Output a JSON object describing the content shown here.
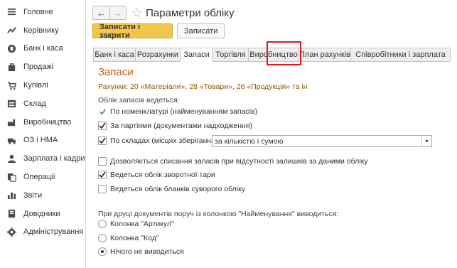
{
  "sidebar": {
    "items": [
      {
        "label": "Головне",
        "icon": "menu-icon"
      },
      {
        "label": "Керівнику",
        "icon": "chart-line-icon"
      },
      {
        "label": "Банк і каса",
        "icon": "coin-icon"
      },
      {
        "label": "Продажі",
        "icon": "shopping-bag-icon"
      },
      {
        "label": "Купівлі",
        "icon": "cart-icon"
      },
      {
        "label": "Склад",
        "icon": "warehouse-icon"
      },
      {
        "label": "Виробництво",
        "icon": "factory-icon"
      },
      {
        "label": "ОЗ і НМА",
        "icon": "truck-icon"
      },
      {
        "label": "Зарплата і кадри",
        "icon": "person-icon"
      },
      {
        "label": "Операції",
        "icon": "operations-icon"
      },
      {
        "label": "Звіти",
        "icon": "bar-chart-icon"
      },
      {
        "label": "Довідники",
        "icon": "book-icon"
      },
      {
        "label": "Адміністрування",
        "icon": "gear-icon"
      }
    ]
  },
  "header": {
    "back": "←",
    "forward": "→",
    "star": "☆",
    "title": "Параметри обліку"
  },
  "toolbar": {
    "save_close_label": "Записати і закрити",
    "save_label": "Записати"
  },
  "tabs": [
    {
      "label": "Банк і каса",
      "active": false
    },
    {
      "label": "Розрахунки",
      "active": false
    },
    {
      "label": "Запаси",
      "active": true
    },
    {
      "label": "Торгівля",
      "active": false
    },
    {
      "label": "Виробництво",
      "active": false
    },
    {
      "label": "План рахунків",
      "active": false
    },
    {
      "label": "Співробітники і зарплата",
      "active": false
    }
  ],
  "content": {
    "heading": "Запаси",
    "accounts": "Рахунки: 20 «Матеріали», 28 «Товари», 26 «Продукція» та ін",
    "section_label": "Облік запасів ведеться:",
    "by_nomenclature": "По номенклатурі (найменуванням запасів)",
    "by_batches": "За партіями (документами надходження)",
    "by_warehouses": "По складах (місцях зберігання):",
    "warehouse_select": "за кількістю і сумою",
    "allow_writeoff": "Дозволяється списання запасів при відсутності залишків за даними обліку",
    "returnable_packaging": "Ведеться облік зворотної тари",
    "strict_forms": "Ведеться облік бланків суворого обліку",
    "print_label": "При друці документів поруч із колонкою \"Найменування\" виводиться:",
    "radio_article": "Колонка \"Артикул\"",
    "radio_code": "Колонка \"Код\"",
    "radio_nothing": "Нічого не виводиться"
  },
  "state": {
    "by_batches": true,
    "by_warehouses": true,
    "allow_writeoff": false,
    "returnable_packaging": true,
    "strict_forms": false,
    "print_column": "nothing"
  },
  "colors": {
    "primary_button": "#f3c64a",
    "heading": "#c75a0a",
    "accounts_text": "#8a5a00",
    "tab_highlight": "#e0161e",
    "check_green": "#3a9a3a"
  }
}
